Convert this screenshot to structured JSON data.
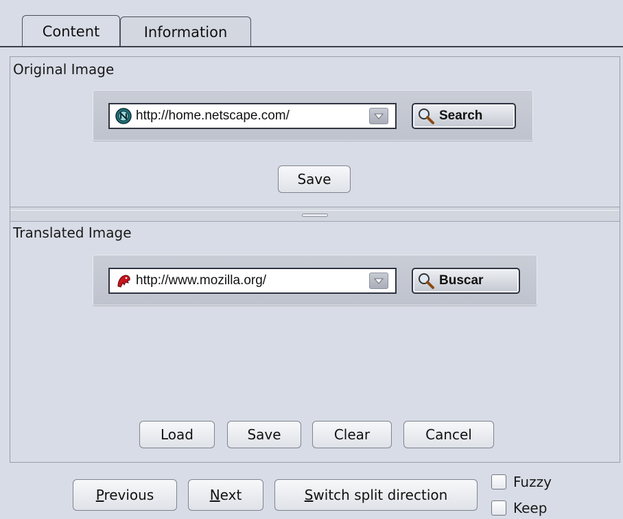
{
  "tabs": [
    {
      "label": "Content",
      "active": true
    },
    {
      "label": "Information",
      "active": false
    }
  ],
  "original": {
    "label": "Original Image",
    "url": "http://home.netscape.com/",
    "site_icon": "netscape-icon",
    "search_label": "Search",
    "save_label": "Save"
  },
  "translated": {
    "label": "Translated Image",
    "url": "http://www.mozilla.org/",
    "site_icon": "mozilla-icon",
    "search_label": "Buscar",
    "buttons": {
      "load": "Load",
      "save": "Save",
      "clear": "Clear",
      "cancel": "Cancel"
    }
  },
  "footer": {
    "previous": "Previous",
    "next": "Next",
    "switch": "Switch split direction",
    "fuzzy": "Fuzzy",
    "keep": "Keep"
  },
  "colors": {
    "background": "#d8dce6",
    "border_dark": "#2e3340",
    "mozilla_red": "#c8141e",
    "netscape_teal": "#1f6f78"
  }
}
